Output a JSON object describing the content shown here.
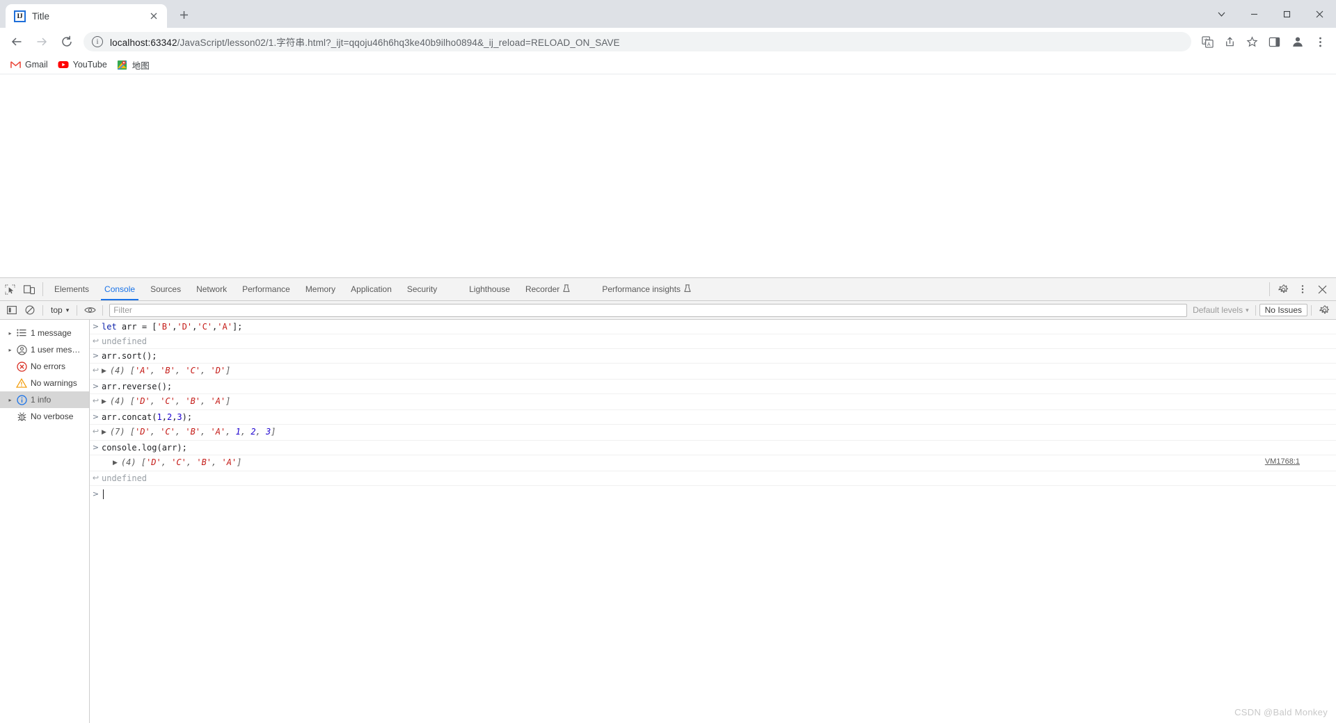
{
  "window": {
    "tab": {
      "title": "Title",
      "favicon_text": "IJ",
      "close_label": "×"
    },
    "new_tab_label": "+",
    "controls": {
      "chevron": "⌄",
      "minimize": "–",
      "maximize": "□",
      "close": "✕"
    }
  },
  "toolbar": {
    "back_label": "←",
    "forward_label": "→",
    "reload_label": "⟳",
    "site_info_label": "i",
    "url_host": "localhost:63342",
    "url_path": "/JavaScript/lesson02/1.字符串.html?_ijt=qqoju46h6hq3ke40b9ilho0894&_ij_reload=RELOAD_ON_SAVE",
    "url_full": "localhost:63342/JavaScript/lesson02/1.字符串.html?_ijt=qqoju46h6hq3ke40b9ilho0894&_ij_reload=RELOAD_ON_SAVE",
    "icons": [
      "translate-icon",
      "share-icon",
      "bookmark-star-icon",
      "side-panel-icon",
      "profile-avatar-icon",
      "more-menu-icon"
    ]
  },
  "bookmarks": [
    {
      "label": "Gmail",
      "icon": "gmail-icon"
    },
    {
      "label": "YouTube",
      "icon": "youtube-icon"
    },
    {
      "label": "地图",
      "icon": "maps-icon"
    }
  ],
  "devtools": {
    "left_icons": [
      "inspect-element-icon",
      "device-toolbar-icon"
    ],
    "tabs": [
      {
        "label": "Elements",
        "active": false,
        "flask": false
      },
      {
        "label": "Console",
        "active": true,
        "flask": false
      },
      {
        "label": "Sources",
        "active": false,
        "flask": false
      },
      {
        "label": "Network",
        "active": false,
        "flask": false
      },
      {
        "label": "Performance",
        "active": false,
        "flask": false
      },
      {
        "label": "Memory",
        "active": false,
        "flask": false
      },
      {
        "label": "Application",
        "active": false,
        "flask": false
      },
      {
        "label": "Security",
        "active": false,
        "flask": false
      },
      {
        "label": "Lighthouse",
        "active": false,
        "flask": false
      },
      {
        "label": "Recorder",
        "active": false,
        "flask": true
      },
      {
        "label": "Performance insights",
        "active": false,
        "flask": true
      }
    ],
    "right_icons": [
      "settings-gear-icon",
      "more-vertical-icon",
      "close-devtools-icon"
    ],
    "console_toolbar": {
      "sidebar_toggle_label": "sidebar-toggle-icon",
      "clear_console_label": "clear-console-icon",
      "context_value": "top",
      "context_caret": "▾",
      "live_expression_label": "eye-icon",
      "filter_placeholder": "Filter",
      "filter_value": "",
      "levels_label": "Default levels",
      "levels_caret": "▾",
      "issues_label": "No Issues",
      "settings_label": "console-settings-icon"
    },
    "sidebar": [
      {
        "label": "1 message",
        "icon": "list-icon",
        "arrow": true,
        "selected": false
      },
      {
        "label": "1 user mes…",
        "icon": "user-icon",
        "arrow": true,
        "selected": false
      },
      {
        "label": "No errors",
        "icon": "error-icon",
        "arrow": false,
        "selected": false
      },
      {
        "label": "No warnings",
        "icon": "warning-icon",
        "arrow": false,
        "selected": false
      },
      {
        "label": "1 info",
        "icon": "info-icon",
        "arrow": true,
        "selected": true
      },
      {
        "label": "No verbose",
        "icon": "bug-icon",
        "arrow": false,
        "selected": false
      }
    ],
    "console_lines": [
      {
        "kind": "input",
        "mark": ">",
        "tokens": [
          {
            "t": "let ",
            "c": "kw"
          },
          {
            "t": "arr",
            "c": "plain"
          },
          {
            "t": " = [",
            "c": "plain"
          },
          {
            "t": "'B'",
            "c": "str"
          },
          {
            "t": ",",
            "c": "plain"
          },
          {
            "t": "'D'",
            "c": "str"
          },
          {
            "t": ",",
            "c": "plain"
          },
          {
            "t": "'C'",
            "c": "str"
          },
          {
            "t": ",",
            "c": "plain"
          },
          {
            "t": "'A'",
            "c": "str"
          },
          {
            "t": "];",
            "c": "plain"
          }
        ]
      },
      {
        "kind": "output",
        "mark": "↩",
        "tokens": [
          {
            "t": "undefined",
            "c": "gray"
          }
        ]
      },
      {
        "kind": "input",
        "mark": ">",
        "tokens": [
          {
            "t": "arr.sort();",
            "c": "plain"
          }
        ]
      },
      {
        "kind": "output",
        "mark": "↩",
        "triangle": true,
        "tokens": [
          {
            "t": "(4) ",
            "c": "arr-meta"
          },
          {
            "t": "[",
            "c": "arr-brk"
          },
          {
            "t": "'A'",
            "c": "arr-str"
          },
          {
            "t": ", ",
            "c": "arr-brk"
          },
          {
            "t": "'B'",
            "c": "arr-str"
          },
          {
            "t": ", ",
            "c": "arr-brk"
          },
          {
            "t": "'C'",
            "c": "arr-str"
          },
          {
            "t": ", ",
            "c": "arr-brk"
          },
          {
            "t": "'D'",
            "c": "arr-str"
          },
          {
            "t": "]",
            "c": "arr-brk"
          }
        ]
      },
      {
        "kind": "input",
        "mark": ">",
        "tokens": [
          {
            "t": "arr.reverse();",
            "c": "plain"
          }
        ]
      },
      {
        "kind": "output",
        "mark": "↩",
        "triangle": true,
        "tokens": [
          {
            "t": "(4) ",
            "c": "arr-meta"
          },
          {
            "t": "[",
            "c": "arr-brk"
          },
          {
            "t": "'D'",
            "c": "arr-str"
          },
          {
            "t": ", ",
            "c": "arr-brk"
          },
          {
            "t": "'C'",
            "c": "arr-str"
          },
          {
            "t": ", ",
            "c": "arr-brk"
          },
          {
            "t": "'B'",
            "c": "arr-str"
          },
          {
            "t": ", ",
            "c": "arr-brk"
          },
          {
            "t": "'A'",
            "c": "arr-str"
          },
          {
            "t": "]",
            "c": "arr-brk"
          }
        ]
      },
      {
        "kind": "input",
        "mark": ">",
        "tokens": [
          {
            "t": "arr.concat(",
            "c": "plain"
          },
          {
            "t": "1",
            "c": "num"
          },
          {
            "t": ",",
            "c": "plain"
          },
          {
            "t": "2",
            "c": "num"
          },
          {
            "t": ",",
            "c": "plain"
          },
          {
            "t": "3",
            "c": "num"
          },
          {
            "t": ");",
            "c": "plain"
          }
        ]
      },
      {
        "kind": "output",
        "mark": "↩",
        "triangle": true,
        "tokens": [
          {
            "t": "(7) ",
            "c": "arr-meta"
          },
          {
            "t": "[",
            "c": "arr-brk"
          },
          {
            "t": "'D'",
            "c": "arr-str"
          },
          {
            "t": ", ",
            "c": "arr-brk"
          },
          {
            "t": "'C'",
            "c": "arr-str"
          },
          {
            "t": ", ",
            "c": "arr-brk"
          },
          {
            "t": "'B'",
            "c": "arr-str"
          },
          {
            "t": ", ",
            "c": "arr-brk"
          },
          {
            "t": "'A'",
            "c": "arr-str"
          },
          {
            "t": ", ",
            "c": "arr-brk"
          },
          {
            "t": "1",
            "c": "arr-num"
          },
          {
            "t": ", ",
            "c": "arr-brk"
          },
          {
            "t": "2",
            "c": "arr-num"
          },
          {
            "t": ", ",
            "c": "arr-brk"
          },
          {
            "t": "3",
            "c": "arr-num"
          },
          {
            "t": "]",
            "c": "arr-brk"
          }
        ]
      },
      {
        "kind": "input",
        "mark": ">",
        "tokens": [
          {
            "t": "console.log(arr);",
            "c": "plain"
          }
        ]
      },
      {
        "kind": "log",
        "mark": "",
        "triangle": true,
        "indent": true,
        "source_link": "VM1768:1",
        "tokens": [
          {
            "t": "(4) ",
            "c": "arr-meta"
          },
          {
            "t": "[",
            "c": "arr-brk"
          },
          {
            "t": "'D'",
            "c": "arr-str"
          },
          {
            "t": ", ",
            "c": "arr-brk"
          },
          {
            "t": "'C'",
            "c": "arr-str"
          },
          {
            "t": ", ",
            "c": "arr-brk"
          },
          {
            "t": "'B'",
            "c": "arr-str"
          },
          {
            "t": ", ",
            "c": "arr-brk"
          },
          {
            "t": "'A'",
            "c": "arr-str"
          },
          {
            "t": "]",
            "c": "arr-brk"
          }
        ]
      },
      {
        "kind": "output",
        "mark": "↩",
        "tokens": [
          {
            "t": "undefined",
            "c": "gray"
          }
        ]
      }
    ],
    "prompt_mark": ">"
  },
  "watermark": "CSDN @Bald Monkey",
  "colors": {
    "accent": "#1a73e8",
    "tabstrip_bg": "#dee1e6",
    "devtools_bg": "#f3f3f3",
    "string_red": "#c41a16",
    "keyword_blue": "#0d22aa",
    "number_blue": "#1c00cf",
    "error_red": "#d93025",
    "warning_orange": "#f29900",
    "info_blue": "#1a73e8"
  }
}
